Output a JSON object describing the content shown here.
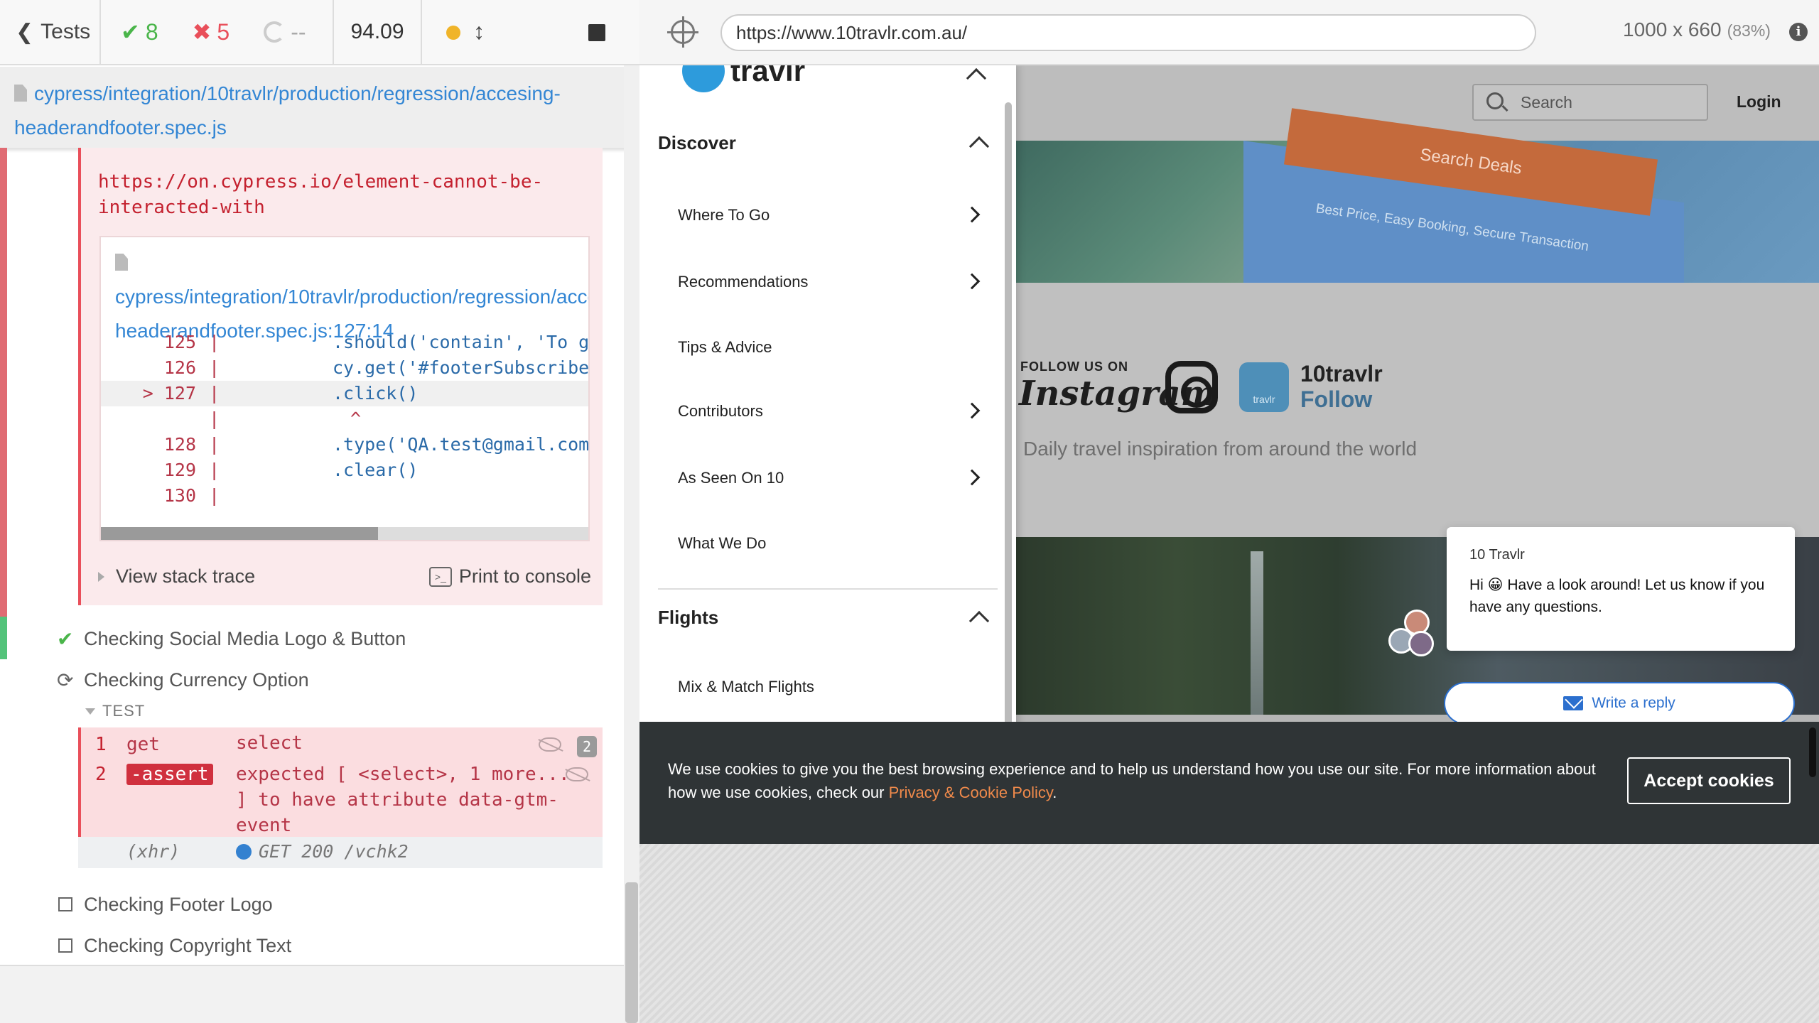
{
  "reporter": {
    "tests_label": "Tests",
    "stats": {
      "passed": "8",
      "failed": "5",
      "pending": "--"
    },
    "duration": "94.09",
    "spec_path": "cypress/integration/10travlr/production/regression/accesing-headerandfooter.spec.js",
    "error": {
      "docs_link": "https://on.cypress.io/element-cannot-be-interacted-with",
      "code_file": "cypress/integration/10travlr/production/regression/accesing-headerandfooter.spec.js:127:14",
      "code_lines": [
        {
          "num": "125",
          "code": ".should('contain', 'To g"
        },
        {
          "num": "126",
          "code": "cy.get('#footerSubscribe"
        },
        {
          "num": "> 127",
          "code": ".click()"
        },
        {
          "num": "",
          "code": " ^"
        },
        {
          "num": "128",
          "code": ".type('QA.test@gmail.com"
        },
        {
          "num": "129",
          "code": ".clear()"
        },
        {
          "num": "130",
          "code": ""
        }
      ],
      "view_stack_trace": "View stack trace",
      "print_to_console": "Print to console"
    },
    "suites": {
      "social_media": "Checking Social Media Logo & Button",
      "currency": "Checking Currency Option",
      "footer_logo": "Checking Footer Logo",
      "copyright": "Checking Copyright Text"
    },
    "test_label": "TEST",
    "commands": [
      {
        "num": "1",
        "name": "get",
        "message": "select"
      },
      {
        "num": "2",
        "name": "-assert",
        "message": "expected [ <select>, 1 more... ] to have attribute data-gtm-event"
      }
    ],
    "command_count": "2",
    "xhr": {
      "type": "(xhr)",
      "message": "GET 200 /vchk2"
    }
  },
  "browser": {
    "url": "https://www.10travlr.com.au/",
    "viewport": "1000 x 660",
    "zoom": "(83%)"
  },
  "site": {
    "logo_text": "travlr",
    "search_placeholder": "Search",
    "login": "Login",
    "hero_button": "Search Deals",
    "hero_tagline": "Best Price, Easy Booking, Secure Transaction",
    "follow_us": "FOLLOW US ON",
    "instagram_word": "Instagram",
    "instagram_badge": "travlr",
    "instagram_name": "10travlr",
    "instagram_follow": "Follow",
    "instagram_tagline": "Daily travel inspiration from around the world",
    "drawer": {
      "discover": "Discover",
      "items": [
        "Where To Go",
        "Recommendations",
        "Tips & Advice",
        "Contributors",
        "As Seen On 10",
        "What We Do"
      ],
      "flights": "Flights",
      "flight_items": [
        "Mix & Match Flights"
      ]
    },
    "chat": {
      "sender": "10 Travlr",
      "message": "Hi 😀  Have a look around! Let us know if you have any questions.",
      "reply": "Write a reply"
    },
    "cookie": {
      "text": "We use cookies to give you the best browsing experience and to help us understand how you use our site. For more information about how we use cookies, check our ",
      "link": "Privacy & Cookie Policy",
      "end": ".",
      "accept": "Accept cookies"
    }
  },
  "colors": {
    "pass": "#4ab54a",
    "fail": "#e94f5a",
    "link": "#3386d4",
    "accent_orange": "#f08a4b"
  }
}
